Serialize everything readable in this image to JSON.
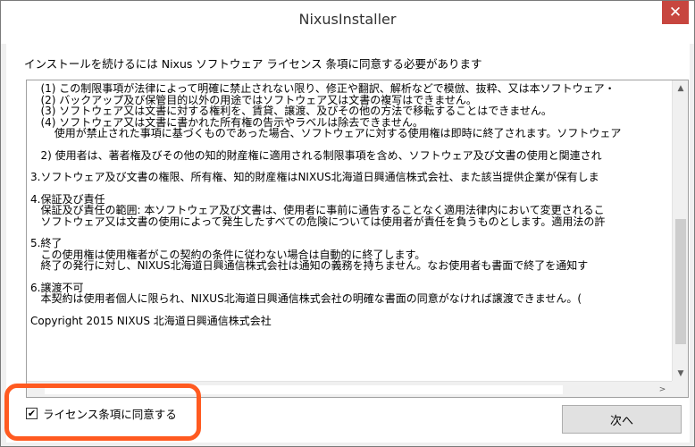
{
  "window": {
    "title": "NixusInstaller",
    "close_label": "✕"
  },
  "heading": "インストールを続けるには Nixus ソフトウェア ライセンス 条項に同意する必要があります",
  "license_lines": [
    "   (1) この制限事項が法律によって明確に禁止されない限り、修正や翻訳、解析などで模倣、抜粋、又は本ソフトウェア・",
    "   (2) バックアップ及び保管目的以外の用途ではソフトウェア又は文書の複写はできません。",
    "   (3) ソフトウェア又は文書に対する権利を、賃貸、譲渡、及びその他の方法で移転することはできません。",
    "   (4) ソフトウェア又は文書に書かれた所有権の告示やラベルは除去できません。",
    "       使用が禁止された事項に基づくものであった場合、ソフトウェアに対する使用権は即時に終了されます。ソフトウェア",
    "",
    "   2) 使用者は、著者権及びその他の知的財産権に適用される制限事項を含め、ソフトウェア及び文書の使用と関連され",
    "",
    "3.ソフトウェア及び文書の権限、所有権、知的財産権はNIXUS北海道日興通信株式会社、また該当提供企業が保有しま",
    "",
    "4.保証及び責任",
    "   保証及び責任の範囲: 本ソフトウェア及び文書は、使用者に事前に通告することなく適用法律内において変更されるこ",
    "   ソフトウェア又は文書の使用によって発生したすべての危険については使用者が責任を負うものとします。適用法の許",
    "",
    "5.終了",
    "   この使用権は使用権者がこの契約の条件に従わない場合は自動的に終了します。",
    "   終了の発行に対し、NIXUS北海道日興通信株式会社は通知の義務を持ちません。なお使用者も書面で終了を通知す",
    "",
    "6.譲渡不可",
    "   本契約は使用者個人に限られ、NIXUS北海道日興通信株式会社の明確な書面の同意がなければ譲渡できません。(",
    "",
    "Copyright 2015 NIXUS 北海道日興通信株式会社"
  ],
  "scroll": {
    "up_arrow": "▲",
    "down_arrow": "▼",
    "left_arrow": "<",
    "right_arrow": ">",
    "scroll_fraction": 0.85
  },
  "agree": {
    "label": "ライセンス条項に同意する",
    "checked": true,
    "check_mark": "✔"
  },
  "next_button": "次へ",
  "colors": {
    "close_button": "#c7463f",
    "highlight": "#ff5a20"
  }
}
